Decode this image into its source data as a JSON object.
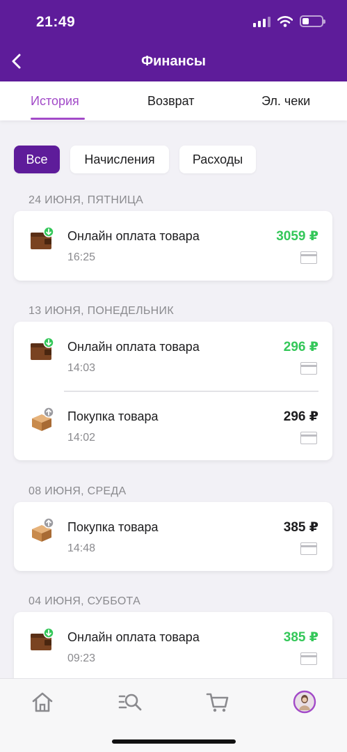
{
  "status": {
    "time": "21:49"
  },
  "header": {
    "title": "Финансы"
  },
  "tabs": [
    {
      "label": "История"
    },
    {
      "label": "Возврат"
    },
    {
      "label": "Эл. чеки"
    }
  ],
  "filters": [
    {
      "label": "Все"
    },
    {
      "label": "Начисления"
    },
    {
      "label": "Расходы"
    }
  ],
  "groups": [
    {
      "date": "24 ИЮНЯ, ПЯТНИЦА",
      "items": [
        {
          "name": "Онлайн оплата товара",
          "time": "16:25",
          "amount": "3059 ₽",
          "type": "income",
          "icon": "wallet-income-icon"
        }
      ]
    },
    {
      "date": "13 ИЮНЯ, ПОНЕДЕЛЬНИК",
      "items": [
        {
          "name": "Онлайн оплата товара",
          "time": "14:03",
          "amount": "296 ₽",
          "type": "income",
          "icon": "wallet-income-icon"
        },
        {
          "name": "Покупка товара",
          "time": "14:02",
          "amount": "296 ₽",
          "type": "expense",
          "icon": "box-expense-icon"
        }
      ]
    },
    {
      "date": "08 ИЮНЯ, СРЕДА",
      "items": [
        {
          "name": "Покупка товара",
          "time": "14:48",
          "amount": "385 ₽",
          "type": "expense",
          "icon": "box-expense-icon"
        }
      ]
    },
    {
      "date": "04 ИЮНЯ, СУББОТА",
      "items": [
        {
          "name": "Онлайн оплата товара",
          "time": "09:23",
          "amount": "385 ₽",
          "type": "income",
          "icon": "wallet-income-icon"
        }
      ]
    }
  ],
  "colors": {
    "brand": "#5e1c9a",
    "accent": "#a24ac8",
    "income": "#34c759"
  },
  "bottom_nav": [
    {
      "icon": "home-icon"
    },
    {
      "icon": "search-catalog-icon"
    },
    {
      "icon": "cart-icon"
    },
    {
      "icon": "profile-avatar-icon"
    }
  ]
}
